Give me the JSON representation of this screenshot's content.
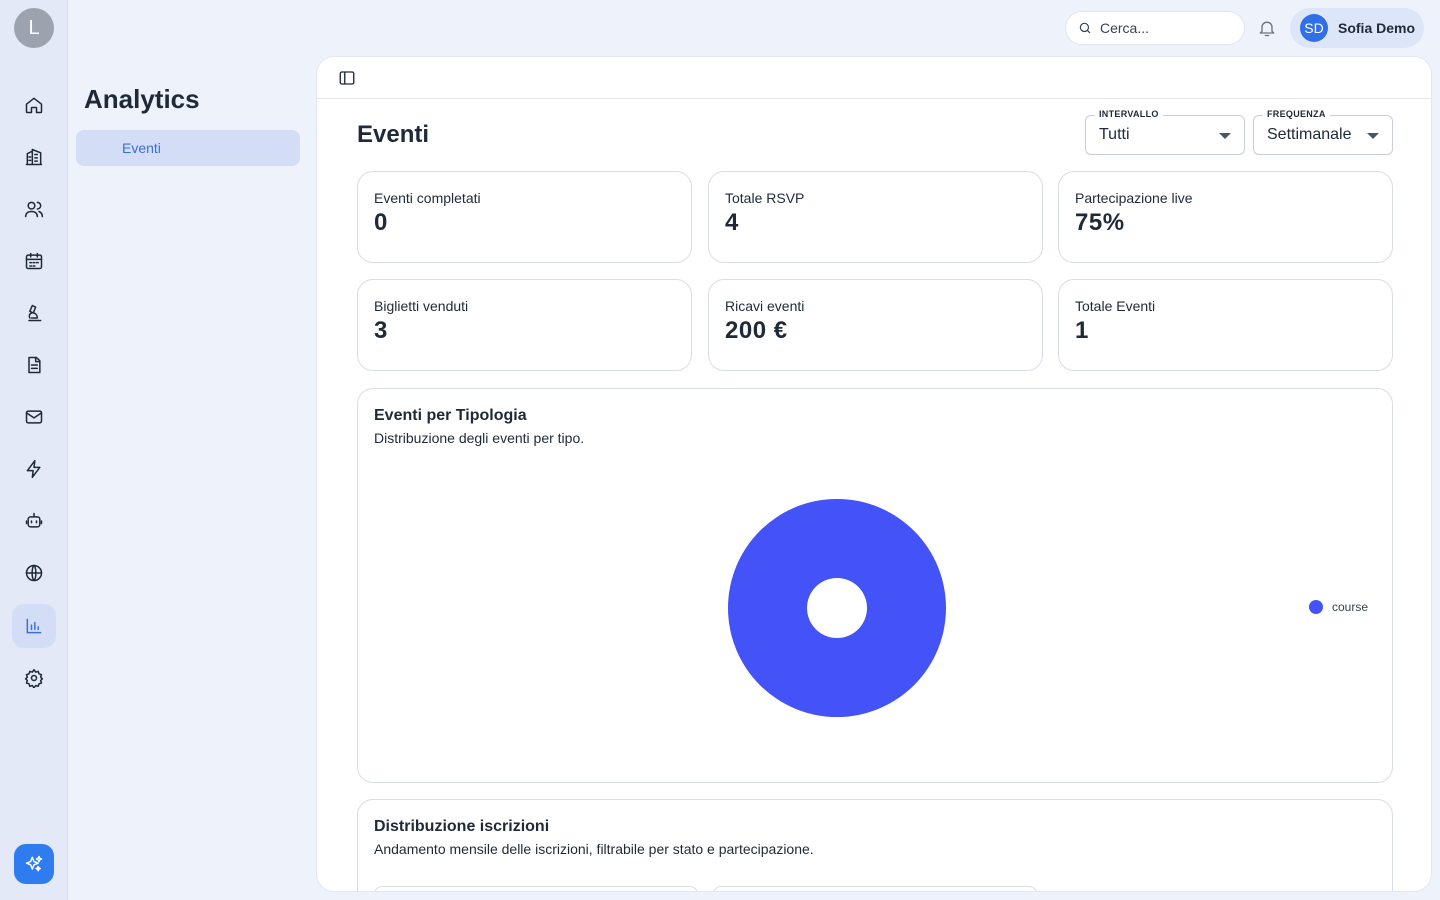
{
  "rail": {
    "avatar_letter": "L",
    "items": [
      {
        "icon": "home-icon"
      },
      {
        "icon": "building-icon"
      },
      {
        "icon": "users-icon"
      },
      {
        "icon": "calendar-icon"
      },
      {
        "icon": "microscope-icon"
      },
      {
        "icon": "document-icon"
      },
      {
        "icon": "mail-icon"
      },
      {
        "icon": "lightning-icon"
      },
      {
        "icon": "bot-icon"
      },
      {
        "icon": "globe-icon"
      },
      {
        "icon": "bar-chart-icon",
        "active": true
      },
      {
        "icon": "gear-icon"
      }
    ],
    "ai_button_icon": "sparkles-icon"
  },
  "subnav": {
    "title": "Analytics",
    "items": [
      {
        "label": "Eventi",
        "active": true
      }
    ]
  },
  "topbar": {
    "search_placeholder": "Cerca...",
    "notification_icon": "bell-icon",
    "user_initials": "SD",
    "user_name": "Sofia Demo"
  },
  "page": {
    "title": "Eventi",
    "filters": {
      "interval": {
        "label": "INTERVALLO",
        "value": "Tutti"
      },
      "frequency": {
        "label": "FREQUENZA",
        "value": "Settimanale"
      }
    },
    "stats": [
      {
        "label": "Eventi completati",
        "value": "0"
      },
      {
        "label": "Totale RSVP",
        "value": "4"
      },
      {
        "label": "Partecipazione live",
        "value": "75%"
      },
      {
        "label": "Biglietti venduti",
        "value": "3"
      },
      {
        "label": "Ricavi eventi",
        "value": "200 €"
      },
      {
        "label": "Totale Eventi",
        "value": "1"
      }
    ],
    "type_card": {
      "title": "Eventi per Tipologia",
      "subtitle": "Distribuzione degli eventi per tipo."
    },
    "subscriptions_card": {
      "title": "Distribuzione iscrizioni",
      "subtitle": "Andamento mensile delle iscrizioni, filtrabile per stato e partecipazione."
    }
  },
  "colors": {
    "accent": "#3b6fd8",
    "donut": "#4353f7",
    "ai_button": "#2f7bf0"
  },
  "chart_data": {
    "type": "pie",
    "categories": [
      "course"
    ],
    "values": [
      1
    ],
    "title": "Eventi per Tipologia",
    "legend": "right",
    "colors": [
      "#4353f7"
    ]
  }
}
